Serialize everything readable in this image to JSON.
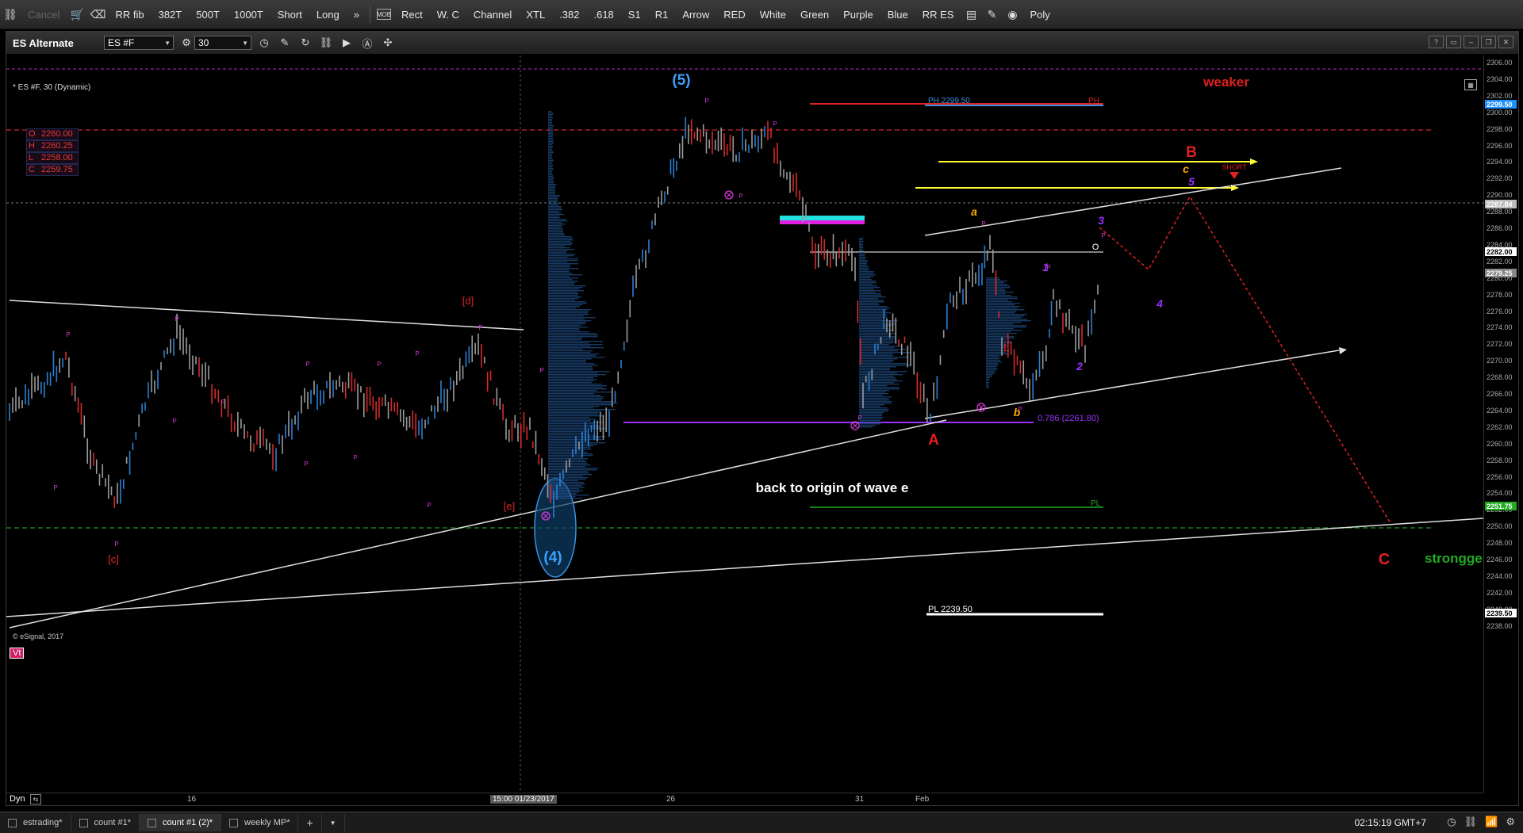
{
  "toolbar": {
    "items": [
      "Cancel",
      "RR fib",
      "382T",
      "500T",
      "1000T",
      "Short",
      "Long",
      "»",
      "Rect",
      "W. C",
      "Channel",
      "XTL",
      ".382",
      ".618",
      "S1",
      "R1",
      "Arrow",
      "RED",
      "White",
      "Green",
      "Purple",
      "Blue",
      "RR ES",
      "Poly"
    ]
  },
  "window": {
    "title": "ES Alternate",
    "symbol": "ES #F",
    "interval": "30",
    "symbol_label": "* ES #F, 30 (Dynamic)"
  },
  "ohlc": {
    "o_key": "O",
    "o": "2260.00",
    "h_key": "H",
    "h": "2260.25",
    "l_key": "L",
    "l": "2258.00",
    "c_key": "C",
    "c": "2259.75"
  },
  "price_axis": {
    "labels": [
      "2306.00",
      "2304.00",
      "2302.00",
      "2300.00",
      "2298.00",
      "2296.00",
      "2294.00",
      "2292.00",
      "2290.00",
      "2288.00",
      "2286.00",
      "2284.00",
      "2282.00",
      "2280.00",
      "2278.00",
      "2276.00",
      "2274.00",
      "2272.00",
      "2270.00",
      "2268.00",
      "2266.00",
      "2264.00",
      "2262.00",
      "2260.00",
      "2258.00",
      "2256.00",
      "2254.00",
      "2252.00",
      "2250.00",
      "2248.00",
      "2246.00",
      "2244.00",
      "2242.00",
      "2240.00",
      "2238.00"
    ],
    "tags": [
      {
        "text": "2299.50",
        "color": "#1e90ff"
      },
      {
        "text": "2287.84",
        "color": "#bbbbbb"
      },
      {
        "text": "2282.00",
        "color": "#ffffff"
      },
      {
        "text": "2279.25",
        "color": "#888888"
      },
      {
        "text": "2251.75",
        "color": "#22aa22"
      },
      {
        "text": "2239.50",
        "color": "#ffffff"
      }
    ]
  },
  "time_axis": {
    "labels": [
      "16",
      "15:00 01/23/2017",
      "26",
      "31",
      "Feb"
    ]
  },
  "annotations": {
    "wave5": "(5)",
    "wave4": "(4)",
    "weaker": "weaker",
    "B": "B",
    "c": "c",
    "five": "5",
    "short": "SHORT",
    "a": "a",
    "three": "3",
    "one": "1",
    "four": "4",
    "two": "2",
    "b": "b",
    "A": "A",
    "C": "C",
    "stronger": "strongger",
    "d": "[d]",
    "e": "[e]",
    "cc": "[c]",
    "back": "back to origin of wave e",
    "ph": "PH 2299.50",
    "ph_r": "PH",
    "pl": "PL",
    "pl2": "PL 2239.50",
    "fib": "0.786 (2261.80)",
    "o_mark": "O",
    "copyright": "© eSignal, 2017",
    "vt": "Vt",
    "dyn": "Dyn",
    "p": "P"
  },
  "tabs": [
    "estrading*",
    "count #1*",
    "count #1 (2)*",
    "weekly MP*"
  ],
  "status": {
    "clock": "02:15:19 GMT+7"
  },
  "colors": {
    "bull": "#2a7fd4",
    "bear": "#d42a2a",
    "neutral": "#9a9a9a",
    "magenta": "#d63ad6",
    "purple": "#9b30ff",
    "yellow": "#ffff33",
    "orange": "#ffaa00"
  }
}
